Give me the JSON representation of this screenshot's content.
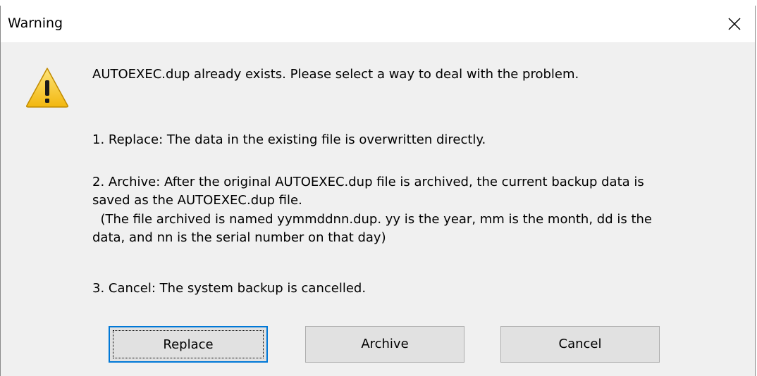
{
  "window": {
    "title": "Warning",
    "close_label": "×"
  },
  "message": {
    "line0": "AUTOEXEC.dup already exists. Please select a way to deal with the problem.",
    "line1": "1. Replace: The data in the existing file is overwritten directly.",
    "line2": "2. Archive: After the original AUTOEXEC.dup file is archived, the current backup data is",
    "line3": "saved as the AUTOEXEC.dup file.",
    "line4": "  (The file archived is named yymmddnn.dup. yy is the year, mm is the month, dd is the",
    "line5": "data, and nn is the serial number on that day)",
    "line6": "3. Cancel: The system backup is cancelled."
  },
  "buttons": {
    "replace": "Replace",
    "archive": "Archive",
    "cancel": "Cancel"
  },
  "icons": {
    "warning": "warning-triangle-icon",
    "close": "close-icon"
  },
  "colors": {
    "dialog_bg": "#f0f0f0",
    "titlebar_bg": "#ffffff",
    "focus_border": "#0078d7",
    "warning_yellow": "#f7c21b"
  }
}
